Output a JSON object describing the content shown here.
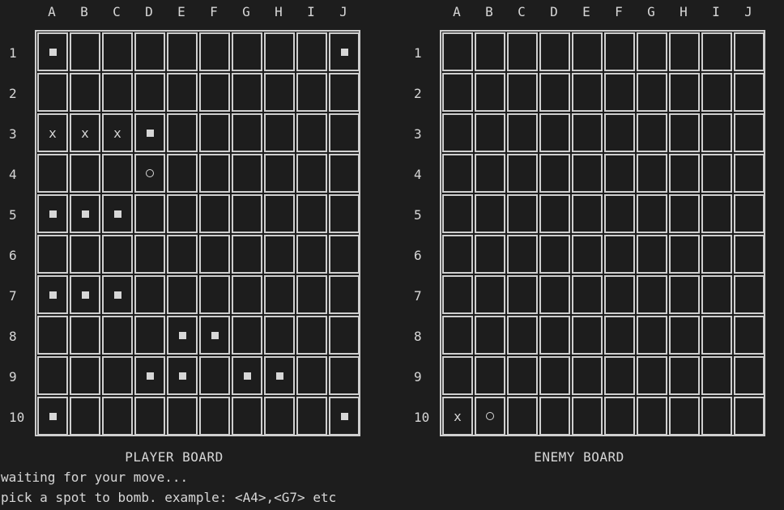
{
  "columns": [
    "A",
    "B",
    "C",
    "D",
    "E",
    "F",
    "G",
    "H",
    "I",
    "J"
  ],
  "rows": [
    "1",
    "2",
    "3",
    "4",
    "5",
    "6",
    "7",
    "8",
    "9",
    "10"
  ],
  "player_board": {
    "title": "PLAYER BOARD",
    "cells": [
      [
        "ship",
        "",
        "",
        "",
        "",
        "",
        "",
        "",
        "",
        "ship"
      ],
      [
        "",
        "",
        "",
        "",
        "",
        "",
        "",
        "",
        "",
        ""
      ],
      [
        "hit",
        "hit",
        "hit",
        "ship",
        "",
        "",
        "",
        "",
        "",
        ""
      ],
      [
        "",
        "",
        "",
        "miss",
        "",
        "",
        "",
        "",
        "",
        ""
      ],
      [
        "ship",
        "ship",
        "ship",
        "",
        "",
        "",
        "",
        "",
        "",
        ""
      ],
      [
        "",
        "",
        "",
        "",
        "",
        "",
        "",
        "",
        "",
        ""
      ],
      [
        "ship",
        "ship",
        "ship",
        "",
        "",
        "",
        "",
        "",
        "",
        ""
      ],
      [
        "",
        "",
        "",
        "",
        "ship",
        "ship",
        "",
        "",
        "",
        ""
      ],
      [
        "",
        "",
        "",
        "ship",
        "ship",
        "",
        "ship",
        "ship",
        "",
        ""
      ],
      [
        "ship",
        "",
        "",
        "",
        "",
        "",
        "",
        "",
        "",
        "ship"
      ]
    ]
  },
  "enemy_board": {
    "title": "ENEMY BOARD",
    "cells": [
      [
        "",
        "",
        "",
        "",
        "",
        "",
        "",
        "",
        "",
        ""
      ],
      [
        "",
        "",
        "",
        "",
        "",
        "",
        "",
        "",
        "",
        ""
      ],
      [
        "",
        "",
        "",
        "",
        "",
        "",
        "",
        "",
        "",
        ""
      ],
      [
        "",
        "",
        "",
        "",
        "",
        "",
        "",
        "",
        "",
        ""
      ],
      [
        "",
        "",
        "",
        "",
        "",
        "",
        "",
        "",
        "",
        ""
      ],
      [
        "",
        "",
        "",
        "",
        "",
        "",
        "",
        "",
        "",
        ""
      ],
      [
        "",
        "",
        "",
        "",
        "",
        "",
        "",
        "",
        "",
        ""
      ],
      [
        "",
        "",
        "",
        "",
        "",
        "",
        "",
        "",
        "",
        ""
      ],
      [
        "",
        "",
        "",
        "",
        "",
        "",
        "",
        "",
        "",
        ""
      ],
      [
        "hit",
        "miss",
        "",
        "",
        "",
        "",
        "",
        "",
        "",
        ""
      ]
    ]
  },
  "symbols": {
    "hit": "x"
  },
  "status": {
    "line1": "waiting for your move...",
    "line2": "pick a spot to bomb. example: <A4>,<G7> etc"
  }
}
